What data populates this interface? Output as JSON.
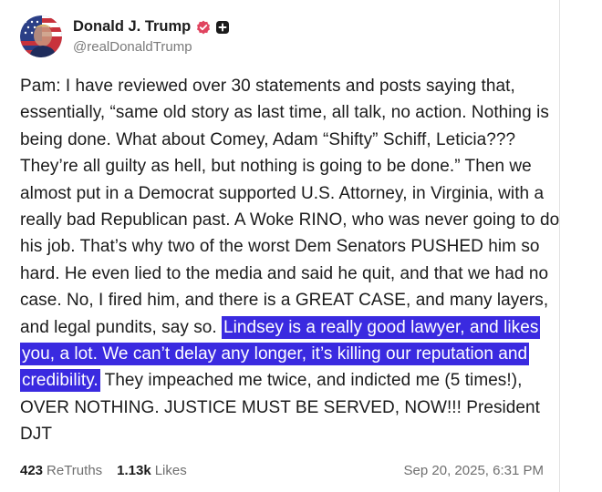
{
  "author": {
    "display_name": "Donald J. Trump",
    "handle": "@realDonaldTrump"
  },
  "post": {
    "text_before_highlight": "Pam: I have reviewed over 30 statements and posts saying that, essentially, “same old story as last time, all talk, no action. Nothing is being done. What about Comey, Adam “Shifty” Schiff, Leticia??? They’re all guilty as hell, but nothing is going to be done.” Then we almost put in a Democrat supported U.S. Attorney, in Virginia, with a really bad Republican past. A Woke RINO, who was never going to do his job. That’s why two of the worst Dem Senators PUSHED him so hard. He even lied to the media and said he quit, and that we had no case. No, I fired him, and there is a GREAT CASE, and many layers, and legal pundits, say so. ",
    "highlighted_text": "Lindsey is a really good lawyer, and likes you, a lot. We can’t delay any longer, it’s killing our reputation and credibility.",
    "text_after_highlight": " They impeached me twice, and indicted me (5 times!), OVER NOTHING. JUSTICE MUST BE SERVED, NOW!!! President DJT"
  },
  "stats": {
    "retruths_count": "423",
    "retruths_label": "ReTruths",
    "likes_count": "1.13k",
    "likes_label": "Likes",
    "timestamp": "Sep 20, 2025, 6:31 PM"
  },
  "colors": {
    "highlight": "#3a2ae0",
    "verified_badge": "#e0445f",
    "muted_text": "#6f6f6f"
  },
  "icons": {
    "verified": "verified-badge-icon",
    "plus": "plus-square-icon"
  }
}
